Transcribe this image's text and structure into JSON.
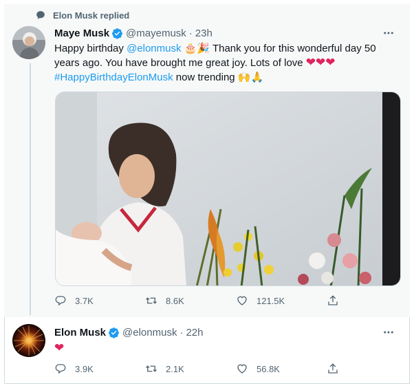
{
  "reply_context": {
    "label": "Elon Musk replied"
  },
  "tweets": [
    {
      "name": "Maye Musk",
      "handle": "@mayemusk",
      "separator": "·",
      "time": "23h",
      "text": {
        "part1": "Happy birthday ",
        "mention": "@elonmusk",
        "part2": " Thank you for this wonderful day 50 years ago. You have brought me great joy. Lots of love ",
        "hashtag": "#HappyBirthdayElonMusk",
        "part3": " now trending "
      },
      "emoji": {
        "cake": "🎂",
        "party": "🎉",
        "hearts": "❤❤❤",
        "hands": "🙌🙏"
      },
      "stats": {
        "replies": "3.7K",
        "retweets": "8.6K",
        "likes": "121.5K"
      }
    },
    {
      "name": "Elon Musk",
      "handle": "@elonmusk",
      "separator": "·",
      "time": "22h",
      "text": {
        "heart": "❤"
      },
      "stats": {
        "replies": "3.9K",
        "retweets": "2.1K",
        "likes": "56.8K"
      }
    }
  ],
  "icons": {
    "replied": "speech-bubble-icon",
    "verified": "verified-badge-icon",
    "more": "more-horizontal-icon",
    "reply": "reply-icon",
    "retweet": "retweet-icon",
    "like": "heart-icon",
    "share": "share-icon"
  },
  "colors": {
    "link": "#1d9bf0",
    "secondary_text": "#536471",
    "verified": "#1d9bf0",
    "heart": "#e0245e",
    "highlight_bg": "#f7f9f9"
  }
}
